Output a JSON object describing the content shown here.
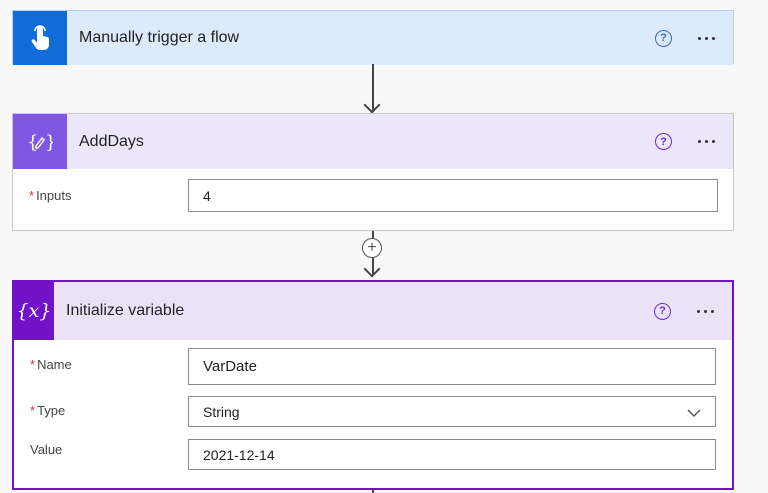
{
  "trigger": {
    "title": "Manually trigger a flow",
    "icon": "touch-icon",
    "color": "#0f6cd9",
    "header_bg": "#ddeafb"
  },
  "adddays": {
    "title": "AddDays",
    "icon": "compose-icon",
    "color": "#7e57e5",
    "header_bg": "#ece6fb",
    "fields": [
      {
        "label": "Inputs",
        "required": "*",
        "value": "4"
      }
    ]
  },
  "initvar": {
    "title": "Initialize variable",
    "icon": "variable-icon",
    "icon_text": "{x}",
    "color": "#7212c8",
    "header_bg": "#ece2f7",
    "fields": [
      {
        "label": "Name",
        "required": "*",
        "value": "VarDate"
      },
      {
        "label": "Type",
        "required": "*",
        "value": "String"
      },
      {
        "label": "Value",
        "required": "",
        "value": "2021-12-14"
      }
    ]
  },
  "common": {
    "help": "?",
    "plus": "+"
  }
}
